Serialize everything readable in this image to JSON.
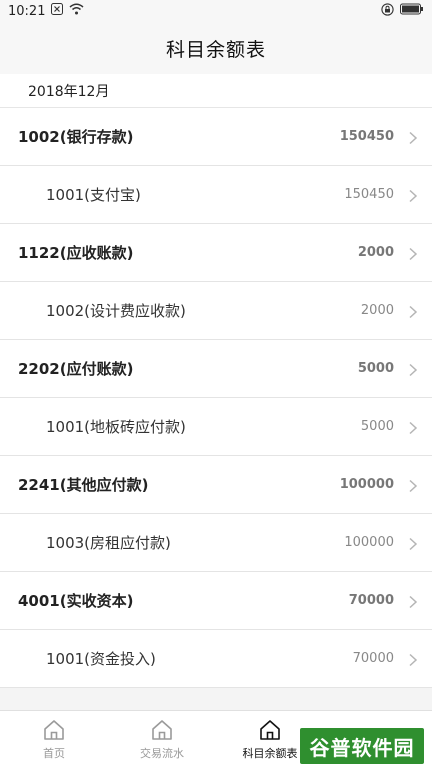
{
  "status_bar": {
    "time": "10:21",
    "icons": [
      "close-box-icon",
      "wifi-icon",
      "lock-rotation-icon",
      "battery-icon"
    ]
  },
  "header": {
    "title": "科目余额表"
  },
  "period": "2018年12月",
  "rows": [
    {
      "type": "parent",
      "name": "1002(银行存款)",
      "amount": "150450"
    },
    {
      "type": "child",
      "name": "1001(支付宝)",
      "amount": "150450"
    },
    {
      "type": "parent",
      "name": "1122(应收账款)",
      "amount": "2000"
    },
    {
      "type": "child",
      "name": "1002(设计费应收款)",
      "amount": "2000"
    },
    {
      "type": "parent",
      "name": "2202(应付账款)",
      "amount": "5000"
    },
    {
      "type": "child",
      "name": "1001(地板砖应付款)",
      "amount": "5000"
    },
    {
      "type": "parent",
      "name": "2241(其他应付款)",
      "amount": "100000"
    },
    {
      "type": "child",
      "name": "1003(房租应付款)",
      "amount": "100000"
    },
    {
      "type": "parent",
      "name": "4001(实收资本)",
      "amount": "70000"
    },
    {
      "type": "child",
      "name": "1001(资金投入)",
      "amount": "70000"
    }
  ],
  "bottom_nav": [
    {
      "label": "首页",
      "icon": "home-icon",
      "active": false
    },
    {
      "label": "交易流水",
      "icon": "home-icon",
      "active": false
    },
    {
      "label": "科目余额表",
      "icon": "home-icon",
      "active": true
    },
    {
      "label": "",
      "icon": "home-icon",
      "active": false
    }
  ],
  "watermark": {
    "text": "谷普软件园",
    "color": "#2f8f2f"
  }
}
